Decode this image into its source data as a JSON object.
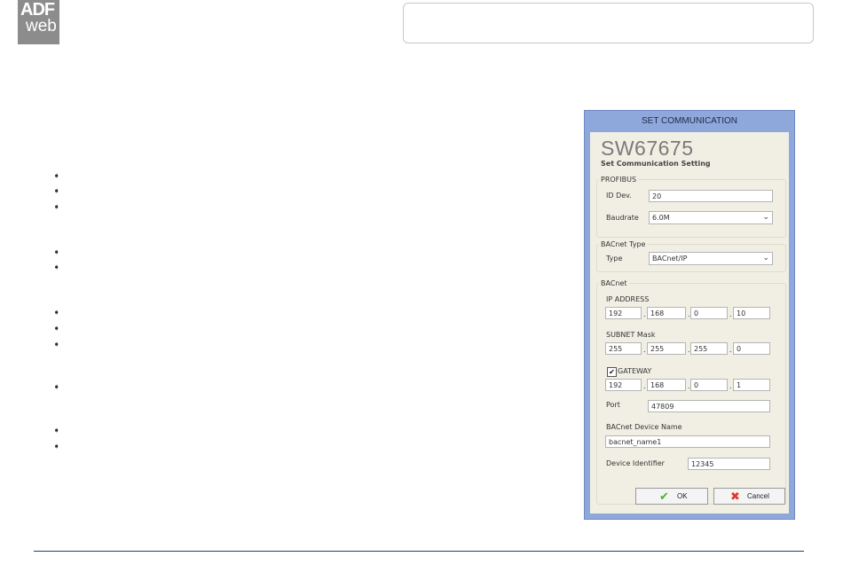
{
  "logo": {
    "line1": "ADF",
    "line2": "web"
  },
  "bullet_glyph": "➧",
  "dialog": {
    "title": "SET COMMUNICATION",
    "product": "SW67675",
    "subtitle": "Set Communication Setting",
    "profibus": {
      "legend": "PROFIBUS",
      "id_label": "ID Dev.",
      "id_value": "20",
      "baud_label": "Baudrate",
      "baud_value": "6.0M"
    },
    "bacnet_type": {
      "legend": "BACnet Type",
      "type_label": "Type",
      "type_value": "BACnet/IP"
    },
    "bacnet": {
      "legend": "BACnet",
      "ip_label": "IP ADDRESS",
      "ip": [
        "192",
        "168",
        "0",
        "10"
      ],
      "subnet_label": "SUBNET Mask",
      "subnet": [
        "255",
        "255",
        "255",
        "0"
      ],
      "gateway_label": "GATEWAY",
      "gateway_checked": true,
      "gateway": [
        "192",
        "168",
        "0",
        "1"
      ],
      "port_label": "Port",
      "port_value": "47809",
      "device_name_label": "BACnet Device Name",
      "device_name_value": "bacnet_name1",
      "device_id_label": "Device Identifier",
      "device_id_value": "12345"
    },
    "ok_label": "OK",
    "cancel_label": "Cancel",
    "check_mark": "✔",
    "dropdown_arrow": "⌄",
    "ok_icon": "✔",
    "cancel_icon": "✖",
    "ip_separator": "."
  }
}
